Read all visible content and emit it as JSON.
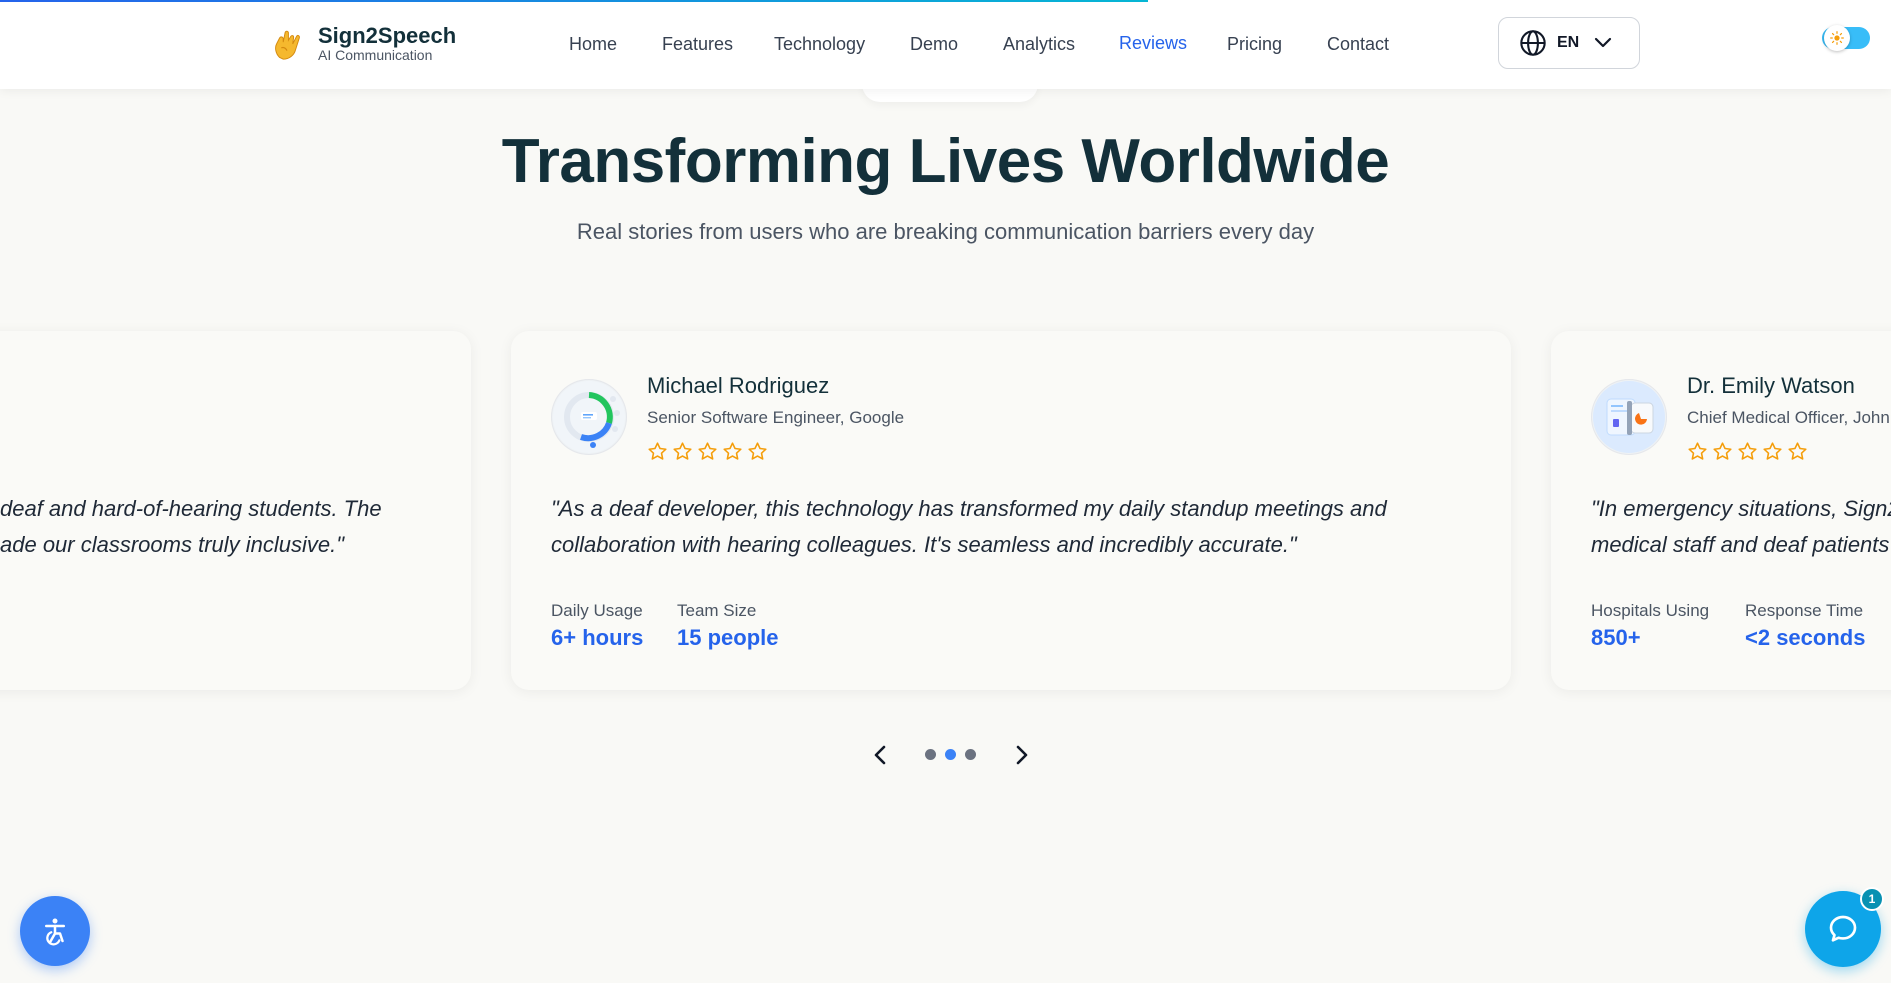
{
  "header": {
    "brand_name": "Sign2Speech",
    "brand_sub": "AI Communication",
    "nav": [
      {
        "label": "Home"
      },
      {
        "label": "Features"
      },
      {
        "label": "Technology"
      },
      {
        "label": "Demo"
      },
      {
        "label": "Analytics"
      },
      {
        "label": "Reviews",
        "active": true
      },
      {
        "label": "Pricing"
      },
      {
        "label": "Contact"
      }
    ],
    "language": "EN"
  },
  "section": {
    "title": "Transforming Lives Worldwide",
    "subtitle": "Real stories from users who are breaking communication barriers every day"
  },
  "testimonials": {
    "left": {
      "quote_line1": "deaf and hard-of-hearing students. The",
      "quote_line2": "ade our classrooms truly inclusive.\""
    },
    "center": {
      "name": "Michael Rodriguez",
      "role": "Senior Software Engineer, Google",
      "rating": 5,
      "quote_line1": "\"As a deaf developer, this technology has transformed my daily standup meetings and",
      "quote_line2": "collaboration with hearing colleagues. It's seamless and incredibly accurate.\"",
      "stats": [
        {
          "label": "Daily Usage",
          "value": "6+ hours"
        },
        {
          "label": "Team Size",
          "value": "15 people"
        }
      ]
    },
    "right": {
      "name": "Dr. Emily Watson",
      "role": "Chief Medical Officer, John",
      "rating": 5,
      "quote_line1": "\"In emergency situations, Sign2",
      "quote_line2": "medical staff and deaf patients",
      "stats": [
        {
          "label": "Hospitals Using",
          "value": "850+"
        },
        {
          "label": "Response Time",
          "value": "<2 seconds"
        }
      ]
    }
  },
  "carousel": {
    "slides": 3,
    "current": 2
  },
  "chat": {
    "badge_count": "1"
  },
  "colors": {
    "accent": "#2563eb",
    "star": "#f59e0b",
    "heading": "#13303a",
    "background": "#f9f9f6"
  },
  "icons": {
    "brand": "hand-sign-icon",
    "language": "globe-icon",
    "language_caret": "chevron-down-icon",
    "theme": "sun-icon",
    "prev": "chevron-left-icon",
    "next": "chevron-right-icon",
    "accessibility": "accessibility-icon",
    "chat": "chat-bubble-icon"
  }
}
